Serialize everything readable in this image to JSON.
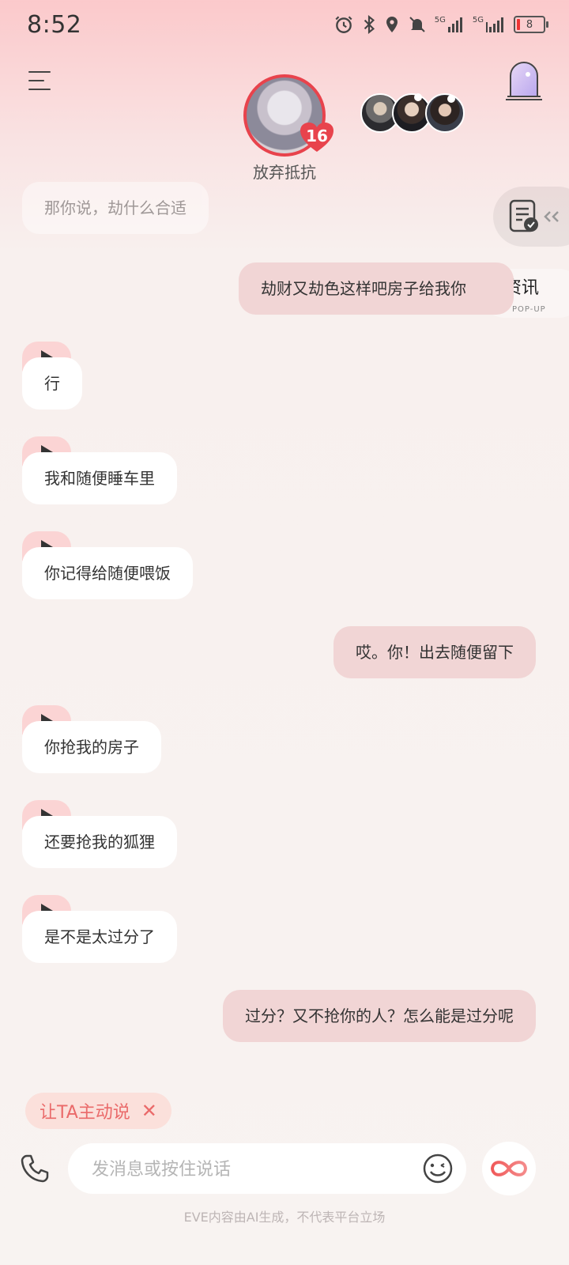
{
  "status_bar": {
    "time": "8:52",
    "battery": "8",
    "network_1": "5G",
    "network_2": "5G"
  },
  "header": {
    "character_name": "放弃抵抗",
    "intimacy_level": "16",
    "accent_color": "#e8434c"
  },
  "side_panel": {
    "news_label": "资讯",
    "news_sublabel": "POP-UP"
  },
  "messages": [
    {
      "role": "ai",
      "text": "那你说，劫什么合适",
      "faded": true
    },
    {
      "role": "me",
      "text": "劫财又劫色这样吧房子给我你"
    },
    {
      "role": "ai",
      "text": "行"
    },
    {
      "role": "ai",
      "text": "我和随便睡车里"
    },
    {
      "role": "ai",
      "text": "你记得给随便喂饭"
    },
    {
      "role": "me",
      "text": "哎。你！出去随便留下"
    },
    {
      "role": "ai",
      "text": "你抢我的房子"
    },
    {
      "role": "ai",
      "text": "还要抢我的狐狸"
    },
    {
      "role": "ai",
      "text": "是不是太过分了"
    },
    {
      "role": "me",
      "text": "过分？又不抢你的人？怎么能是过分呢"
    }
  ],
  "bottom": {
    "proactive_chip": "让TA主动说",
    "close_symbol": "✕",
    "input_placeholder": "发消息或按住说话",
    "input_value": "",
    "footer_note": "EVE内容由AI生成，不代表平台立场"
  }
}
